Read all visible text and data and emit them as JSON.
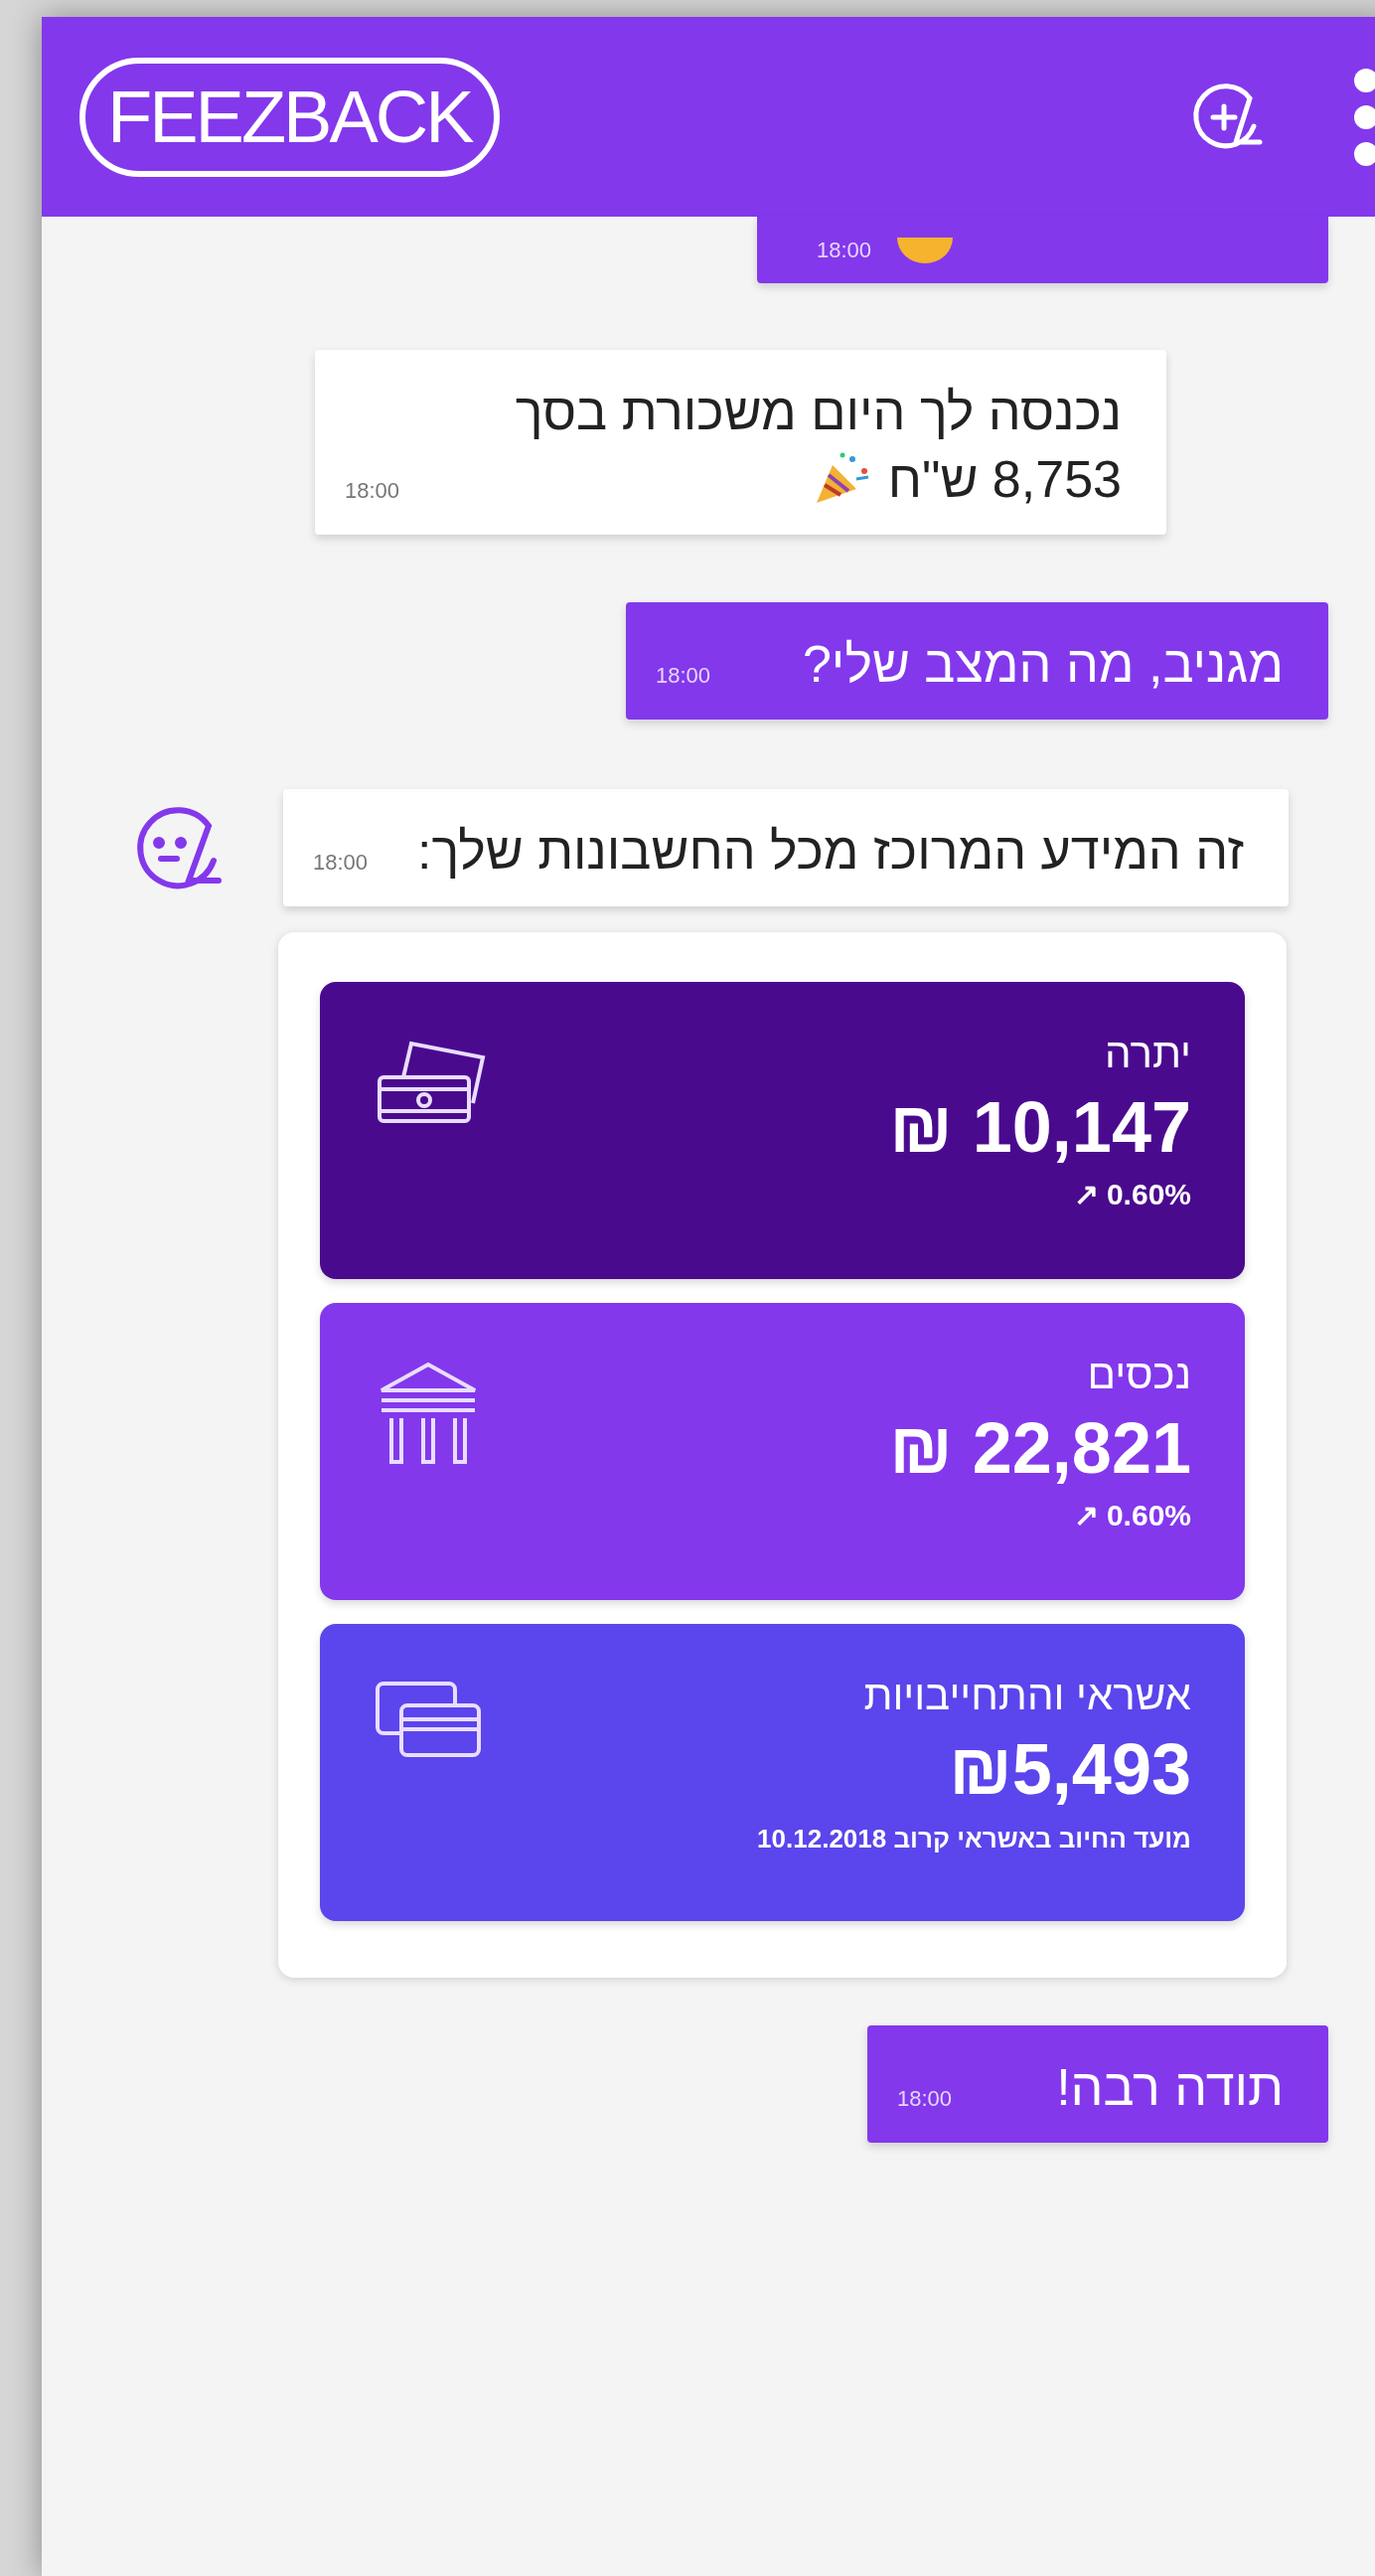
{
  "header": {
    "logo": "FEEZBACK"
  },
  "cut_message": {
    "time": "18:00"
  },
  "messages": [
    {
      "kind": "received",
      "avatar": false,
      "party": true,
      "lines": [
        "נכנסה לך היום משכורת בסך",
        "8,753 ש\"ח"
      ],
      "time": "18:00"
    },
    {
      "kind": "sent",
      "avatar": false,
      "party": false,
      "lines": [
        "מגניב, מה המצב שלי?"
      ],
      "time": "18:00"
    },
    {
      "kind": "received",
      "avatar": true,
      "party": false,
      "lines": [
        "זה המידע המרוכז מכל החשבונות שלך:"
      ],
      "time": "18:00"
    }
  ],
  "summary_cards": [
    {
      "kind": "balance",
      "color": "#4a0a8e",
      "label": "יתרה",
      "amount": "₪ 10,147",
      "change": "↗ 0.60%"
    },
    {
      "kind": "assets",
      "color": "#8338ec",
      "label": "נכסים",
      "amount": "₪ 22,821",
      "change": "↗ 0.60%"
    },
    {
      "kind": "credit",
      "color": "#5b45ec",
      "label": "אשראי והתחייבויות",
      "amount": "₪5,493",
      "note": "מועד החיוב באשראי קרוב 10.12.2018"
    }
  ],
  "final_message": {
    "kind": "sent",
    "text": "תודה רבה!",
    "time": "18:00"
  }
}
